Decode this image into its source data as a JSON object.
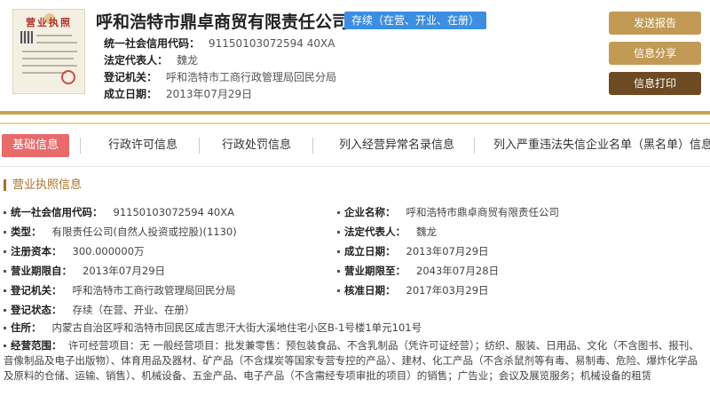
{
  "thumbnail": {
    "title": "营业执照"
  },
  "header": {
    "company_name": "呼和浩特市鼎卓商贸有限责任公司",
    "status": "存续（在营、开业、在册）",
    "credit_code_label": "统一社会信用代码：",
    "credit_code": "91150103072594 40XA",
    "legal_rep_label": "法定代表人：",
    "legal_rep": "魏龙",
    "authority_label": "登记机关：",
    "authority": "呼和浩特市工商行政管理局回民分局",
    "established_label": "成立日期：",
    "established": "2013年07月29日"
  },
  "actions": {
    "send_report": "发送报告",
    "share": "信息分享",
    "print": "信息打印"
  },
  "tabs": [
    "基础信息",
    "行政许可信息",
    "行政处罚信息",
    "列入经营异常名录信息",
    "列入严重违法失信企业名单（黑名单）信息"
  ],
  "section": {
    "title": "营业执照信息"
  },
  "fields": {
    "credit_code": {
      "label": "统一社会信用代码：",
      "value": "91150103072594 40XA"
    },
    "company_name": {
      "label": "企业名称：",
      "value": "呼和浩特市鼎卓商贸有限责任公司"
    },
    "type": {
      "label": "类型：",
      "value": "有限责任公司(自然人投资或控股)(1130)"
    },
    "legal_rep": {
      "label": "法定代表人：",
      "value": "魏龙"
    },
    "capital": {
      "label": "注册资本：",
      "value": "300.000000万"
    },
    "established": {
      "label": "成立日期：",
      "value": "2013年07月29日"
    },
    "term_from": {
      "label": "营业期限自：",
      "value": "2013年07月29日"
    },
    "term_to": {
      "label": "营业期限至：",
      "value": "2043年07月28日"
    },
    "authority": {
      "label": "登记机关：",
      "value": "呼和浩特市工商行政管理局回民分局"
    },
    "approved": {
      "label": "核准日期：",
      "value": "2017年03月29日"
    },
    "reg_status": {
      "label": "登记状态：",
      "value": "存续（在营、开业、在册）"
    },
    "address": {
      "label": "住所：",
      "value": "内蒙古自治区呼和浩特市回民区成吉思汗大街大溪地住宅小区B-1号楼1单元101号"
    },
    "scope": {
      "label": "经营范围：",
      "value": "许可经营项目：无 一般经营项目：批发兼零售：预包装食品、不含乳制品（凭许可证经营）；纺织、服装、日用品、文化（不含图书、报刊、音像制品及电子出版物）、体育用品及器材、矿产品（不含煤炭等国家专营专控的产品）、建材、化工产品（不含杀鼠剂等有毒、易制毒、危险、爆炸化学品及原料的仓储、运输、销售）、机械设备、五金产品、电子产品（不含需经专项审批的项目）的销售；广告业；会议及展览服务；机械设备的租赁"
    }
  }
}
